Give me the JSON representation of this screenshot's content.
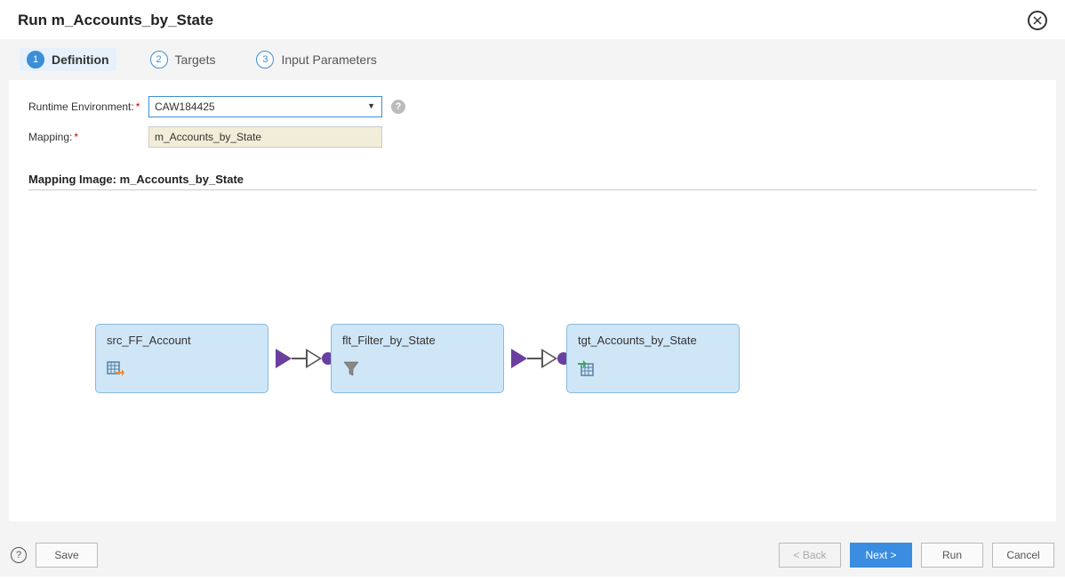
{
  "header": {
    "title": "Run m_Accounts_by_State"
  },
  "tabs": [
    {
      "num": "1",
      "label": "Definition",
      "active": true
    },
    {
      "num": "2",
      "label": "Targets",
      "active": false
    },
    {
      "num": "3",
      "label": "Input Parameters",
      "active": false
    }
  ],
  "form": {
    "runtime_label": "Runtime Environment:",
    "runtime_value": "CAW184425",
    "mapping_label": "Mapping:",
    "mapping_value": "m_Accounts_by_State"
  },
  "section": {
    "title_prefix": "Mapping Image:  ",
    "title_value": "m_Accounts_by_State"
  },
  "nodes": {
    "source": "src_FF_Account",
    "filter": "flt_Filter_by_State",
    "target": "tgt_Accounts_by_State"
  },
  "footer": {
    "save": "Save",
    "back": "< Back",
    "next": "Next >",
    "run": "Run",
    "cancel": "Cancel"
  }
}
